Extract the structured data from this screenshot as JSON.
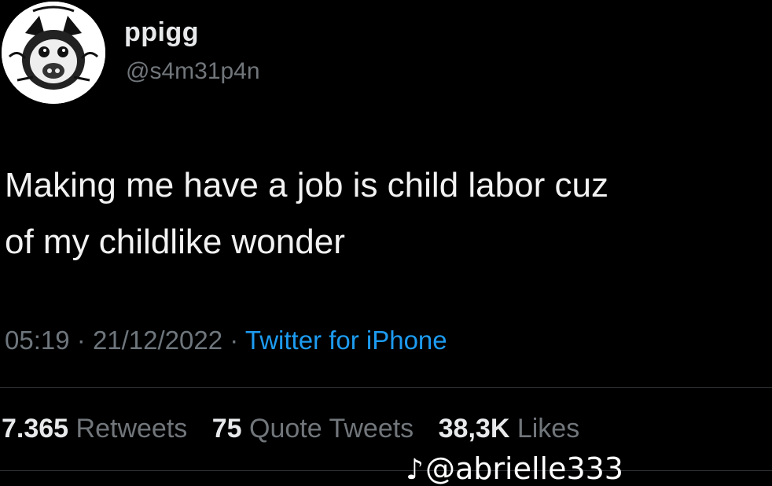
{
  "author": {
    "display_name": "ppigg",
    "handle": "@s4m31p4n",
    "avatar_icon": "cartoon-pig-avatar-icon"
  },
  "tweet": {
    "lines": [
      "Making me have a job is child labor cuz",
      "of my childlike wonder"
    ]
  },
  "meta": {
    "time": "05:19",
    "date": "21/12/2022",
    "separator": "·",
    "source": "Twitter for iPhone"
  },
  "stats": {
    "retweets_count": "7.365",
    "retweets_label": "Retweets",
    "quotes_count": "75",
    "quotes_label": "Quote Tweets",
    "likes_count": "38,3K",
    "likes_label": "Likes"
  },
  "watermark": {
    "icon": "tiktok-icon",
    "text": "@abrielle333"
  },
  "colors": {
    "background": "#000000",
    "text": "#e7e9ea",
    "muted": "#71767b",
    "link": "#1d9bf0"
  }
}
